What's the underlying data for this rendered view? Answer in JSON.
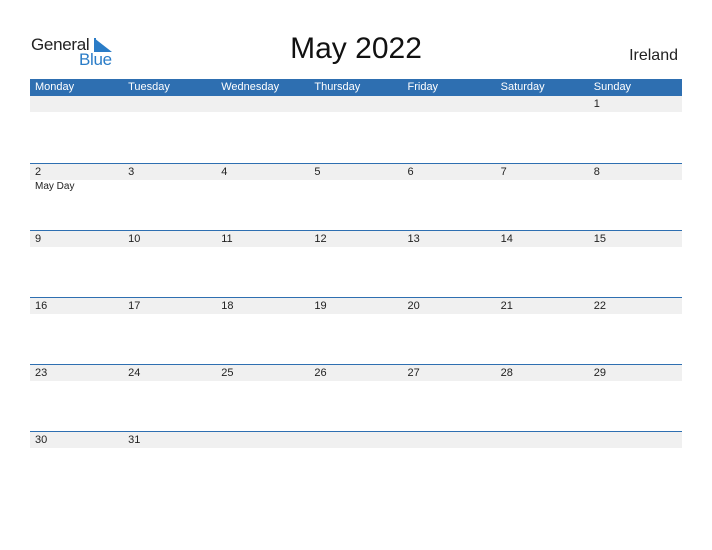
{
  "logo": {
    "line1": "General",
    "line2": "Blue"
  },
  "title": "May 2022",
  "country": "Ireland",
  "accent_color": "#2e6fb1",
  "weekdays": [
    "Monday",
    "Tuesday",
    "Wednesday",
    "Thursday",
    "Friday",
    "Saturday",
    "Sunday"
  ],
  "weeks": [
    {
      "days": [
        "",
        "",
        "",
        "",
        "",
        "",
        "1"
      ],
      "events": [
        "",
        "",
        "",
        "",
        "",
        "",
        ""
      ]
    },
    {
      "days": [
        "2",
        "3",
        "4",
        "5",
        "6",
        "7",
        "8"
      ],
      "events": [
        "May Day",
        "",
        "",
        "",
        "",
        "",
        ""
      ]
    },
    {
      "days": [
        "9",
        "10",
        "11",
        "12",
        "13",
        "14",
        "15"
      ],
      "events": [
        "",
        "",
        "",
        "",
        "",
        "",
        ""
      ]
    },
    {
      "days": [
        "16",
        "17",
        "18",
        "19",
        "20",
        "21",
        "22"
      ],
      "events": [
        "",
        "",
        "",
        "",
        "",
        "",
        ""
      ]
    },
    {
      "days": [
        "23",
        "24",
        "25",
        "26",
        "27",
        "28",
        "29"
      ],
      "events": [
        "",
        "",
        "",
        "",
        "",
        "",
        ""
      ]
    },
    {
      "days": [
        "30",
        "31",
        "",
        "",
        "",
        "",
        ""
      ],
      "events": [
        "",
        "",
        "",
        "",
        "",
        "",
        ""
      ]
    }
  ]
}
